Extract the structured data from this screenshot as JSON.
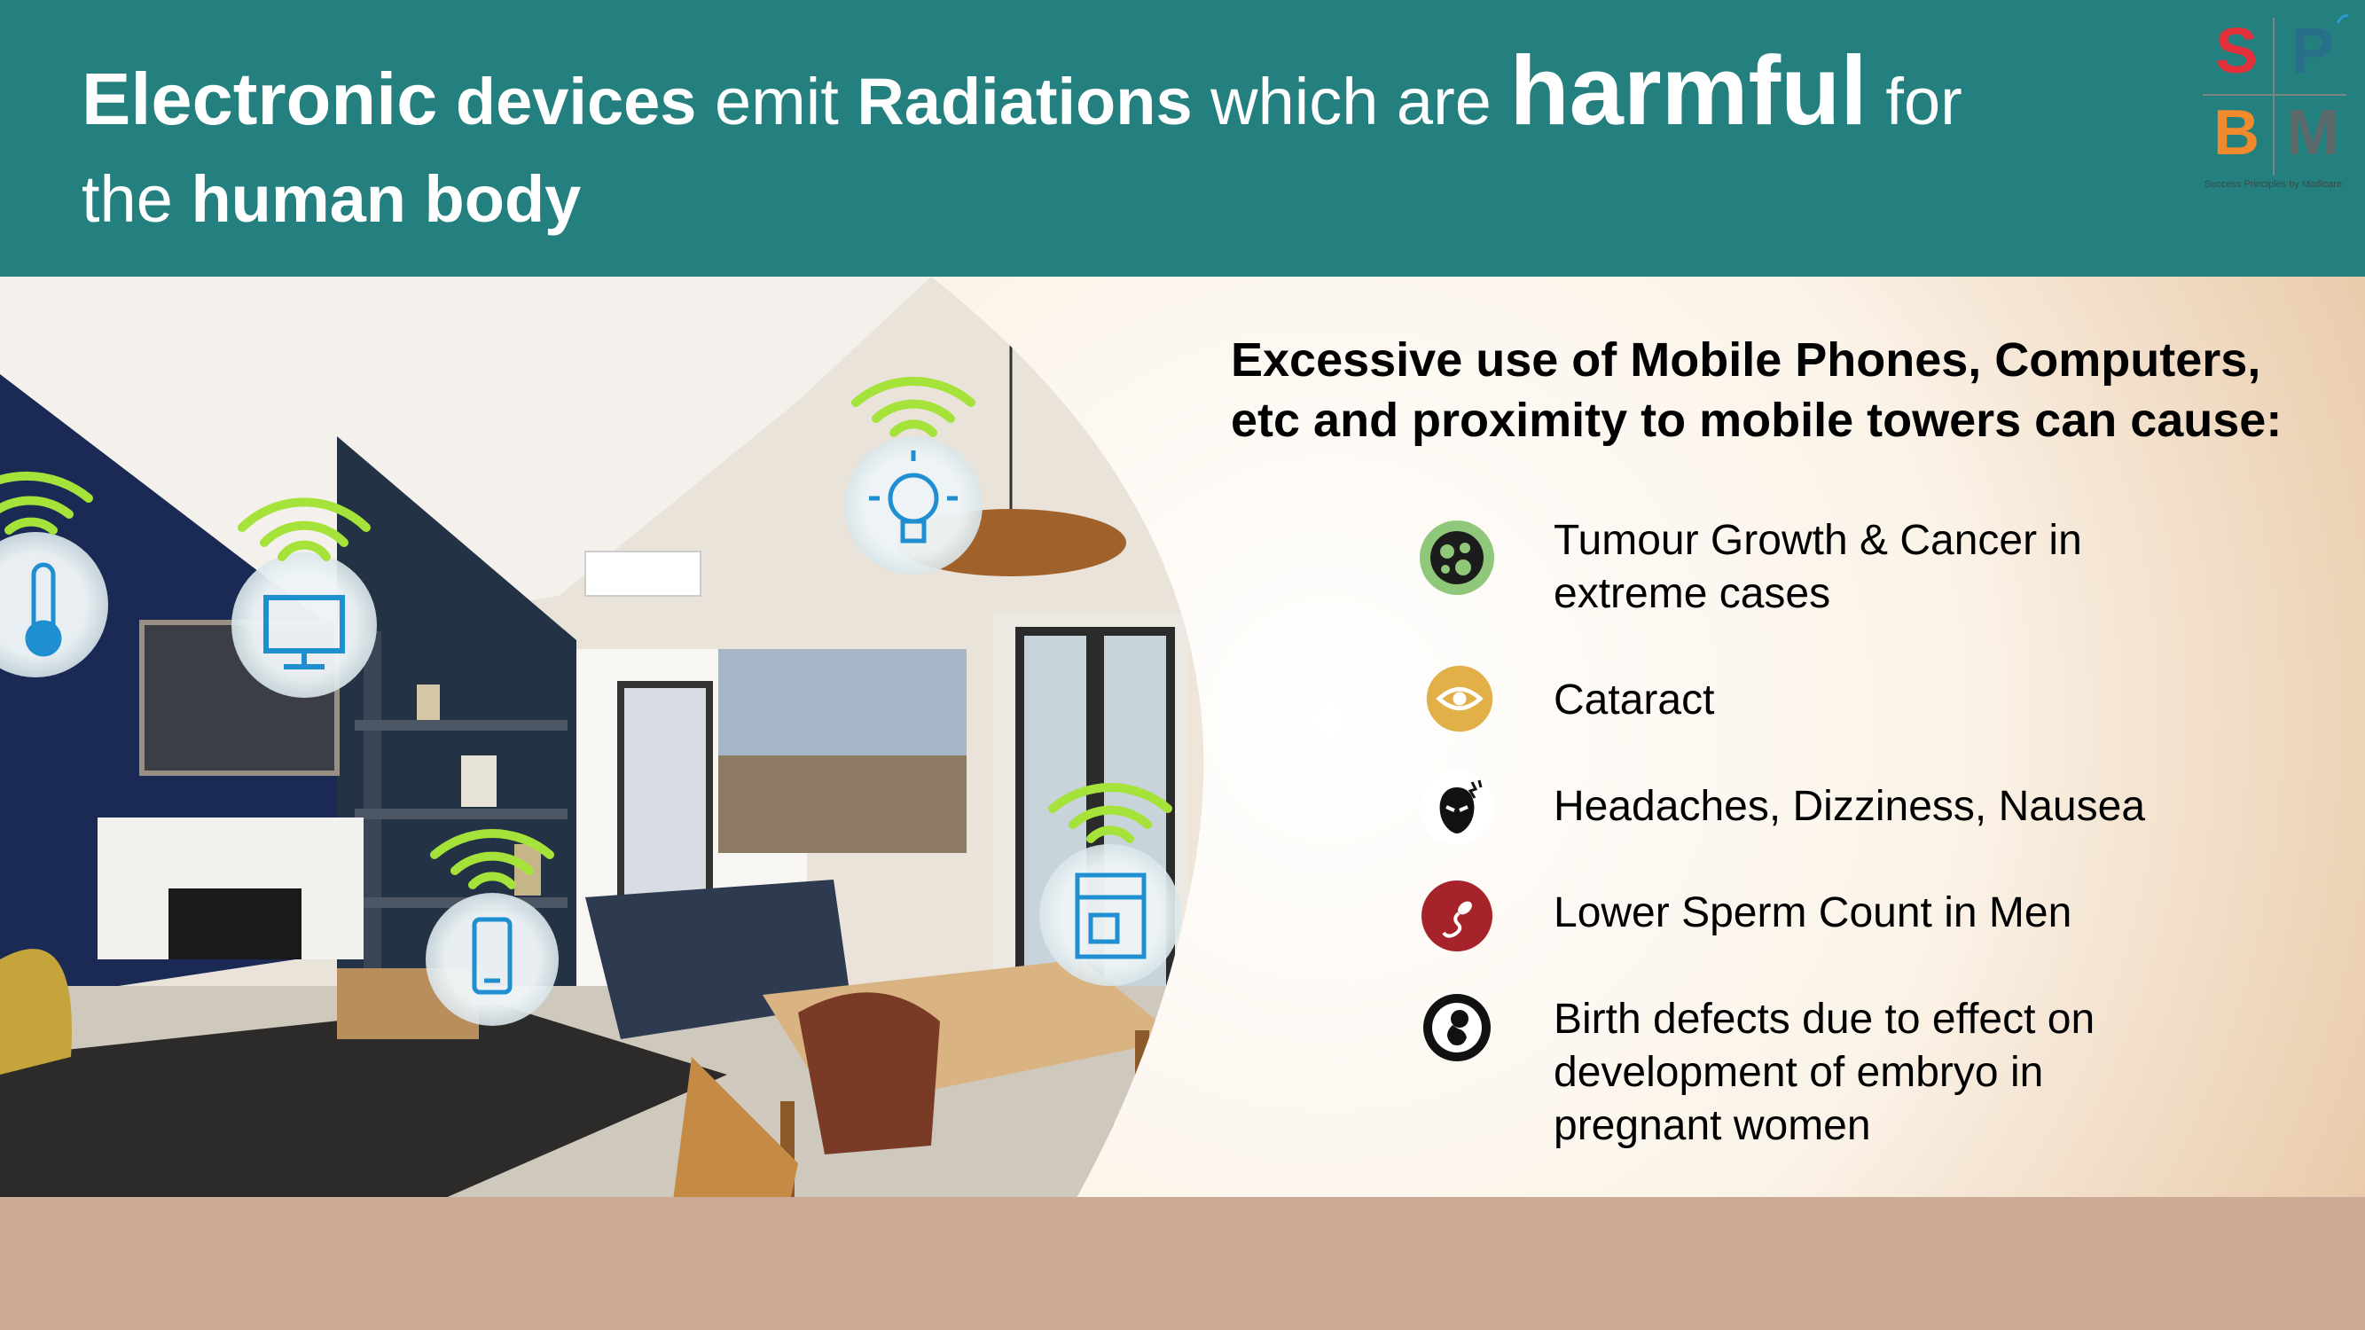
{
  "slide": {
    "title": {
      "line1": [
        {
          "text": "Electronic",
          "style": "b"
        },
        {
          "text": " devices",
          "style": "m"
        },
        {
          "text": " emit ",
          "style": "r"
        },
        {
          "text": "Radiations",
          "style": "m"
        },
        {
          "text": " which are ",
          "style": "r"
        },
        {
          "text": "harmful",
          "style": "xl"
        },
        {
          "text": " for",
          "style": "r"
        }
      ],
      "line2": [
        {
          "text": "the ",
          "style": "r"
        },
        {
          "text": "human body",
          "style": "m"
        }
      ]
    },
    "logo": {
      "letters": [
        "S",
        "P",
        "B",
        "M"
      ],
      "colors": [
        "#e2313a",
        "#2a6f8a",
        "#f08a2c",
        "#5c6a6a"
      ],
      "tagline": "Success Principles by Modicare"
    },
    "heading": {
      "line1": "Excessive use of Mobile Phones, Computers,",
      "line2": "etc and proximity to mobile towers can cause:"
    },
    "effects": [
      {
        "icon": "cell-tumour-icon",
        "color": "#8fc87a",
        "lines": [
          "Tumour Growth & Cancer in",
          "extreme cases"
        ]
      },
      {
        "icon": "eye-icon",
        "color": "#e2b048",
        "lines": [
          "Cataract"
        ]
      },
      {
        "icon": "headache-face-icon",
        "color": "#ffffff",
        "lines": [
          "Headaches, Dizziness, Nausea"
        ]
      },
      {
        "icon": "sperm-icon",
        "color": "#a7232b",
        "lines": [
          "Lower Sperm Count in Men"
        ]
      },
      {
        "icon": "embryo-icon",
        "color": "#ffffff",
        "lines": [
          "Birth defects due to effect on",
          "development of embryo in",
          "pregnant women"
        ]
      }
    ],
    "device_icons": [
      "thermometer-icon",
      "monitor-icon",
      "lightbulb-icon",
      "smartphone-icon",
      "coffee-machine-icon"
    ],
    "wifi_color": "#a5e23a",
    "header_color": "#247f7f"
  }
}
